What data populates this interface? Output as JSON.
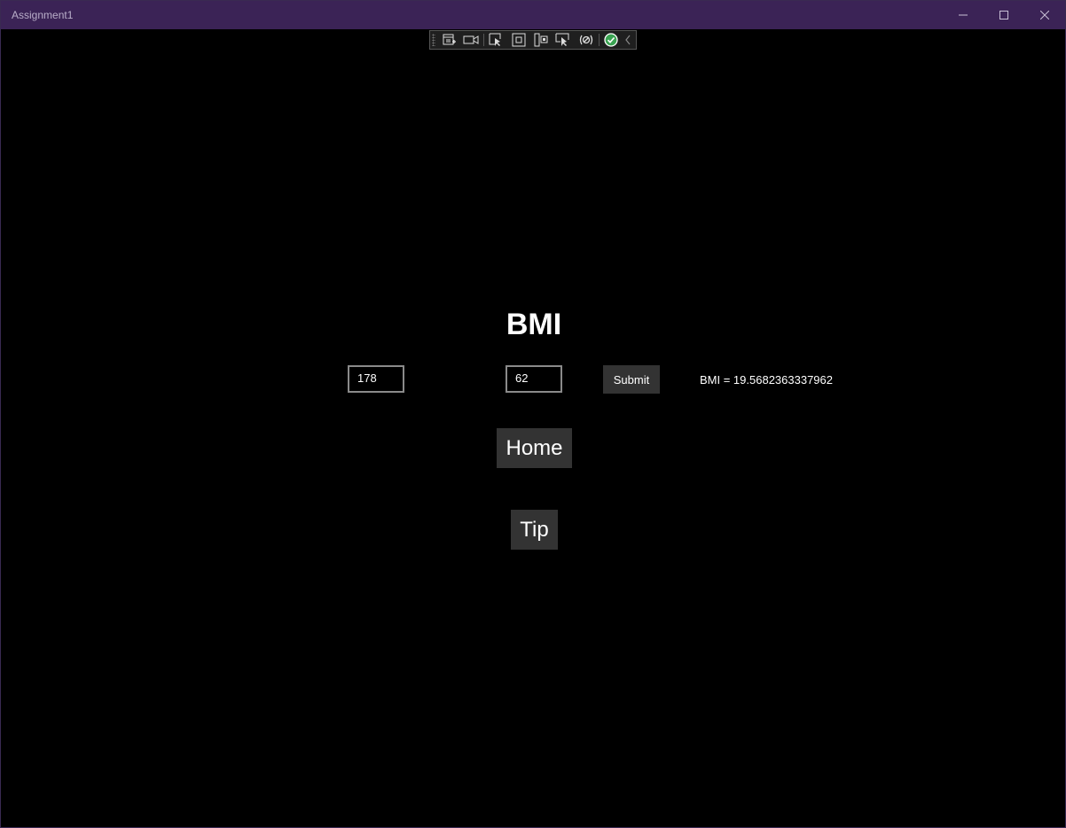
{
  "window": {
    "title": "Assignment1",
    "titlebar_color": "#3b2356"
  },
  "debug_toolbar": {
    "icons": [
      "live-visual-tree-icon",
      "video-icon",
      "select-element-icon",
      "display-layout-adorners-icon",
      "track-focus-icon",
      "binding-failures-icon",
      "hot-reload-icon",
      "hot-reload-status-icon",
      "collapse-toolbar-icon"
    ]
  },
  "page": {
    "heading": "BMI",
    "height_value": "178",
    "weight_value": "62",
    "submit_label": "Submit",
    "result": "BMI = 19.5682363337962",
    "home_label": "Home",
    "tip_label": "Tip"
  }
}
